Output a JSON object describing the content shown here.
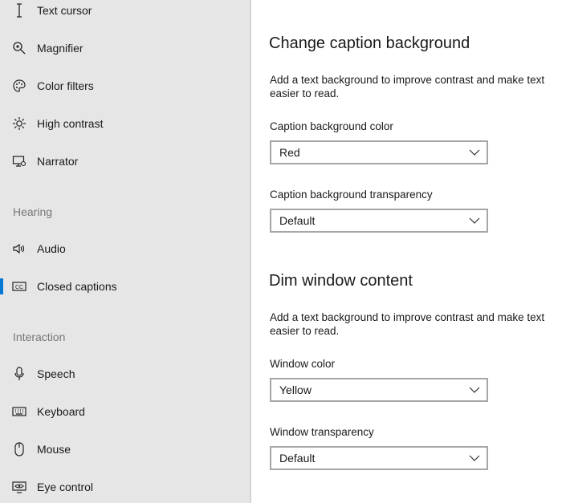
{
  "sidebar": {
    "vision_items": [
      {
        "label": "Text cursor",
        "icon": "text-cursor-icon"
      },
      {
        "label": "Magnifier",
        "icon": "magnifier-icon"
      },
      {
        "label": "Color filters",
        "icon": "palette-icon"
      },
      {
        "label": "High contrast",
        "icon": "sun-icon"
      },
      {
        "label": "Narrator",
        "icon": "narrator-icon"
      }
    ],
    "hearing_heading": "Hearing",
    "hearing_items": [
      {
        "label": "Audio",
        "icon": "speaker-icon"
      },
      {
        "label": "Closed captions",
        "icon": "closed-captions-icon",
        "selected": true
      }
    ],
    "interaction_heading": "Interaction",
    "interaction_items": [
      {
        "label": "Speech",
        "icon": "microphone-icon"
      },
      {
        "label": "Keyboard",
        "icon": "keyboard-icon"
      },
      {
        "label": "Mouse",
        "icon": "mouse-icon"
      },
      {
        "label": "Eye control",
        "icon": "eye-control-icon"
      }
    ]
  },
  "main": {
    "caption_bg": {
      "heading": "Change caption background",
      "description": "Add a text background to improve contrast and make text easier to read.",
      "color_label": "Caption background color",
      "color_value": "Red",
      "transparency_label": "Caption background transparency",
      "transparency_value": "Default"
    },
    "dim_window": {
      "heading": "Dim window content",
      "description": "Add a text background to improve contrast and make text easier to read.",
      "color_label": "Window color",
      "color_value": "Yellow",
      "transparency_label": "Window transparency",
      "transparency_value": "Default"
    }
  },
  "colors": {
    "sidebar_bg": "#e6e6e6",
    "accent": "#0078d4",
    "section_heading": "#767676",
    "dropdown_border": "#a6a6a6"
  }
}
